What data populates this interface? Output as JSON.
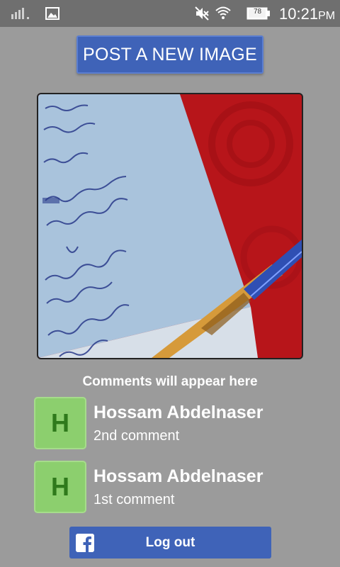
{
  "status_bar": {
    "battery_level": "78",
    "time": "10:21",
    "ampm": "PM",
    "icons": [
      "signal-icon",
      "gallery-icon",
      "mute-icon",
      "wifi-icon",
      "battery-icon"
    ]
  },
  "post_button": {
    "label": "POST A NEW IMAGE"
  },
  "image": {
    "description": "photo-of-notebook-with-pen"
  },
  "comments": {
    "heading": "Comments will appear here",
    "items": [
      {
        "avatar_letter": "H",
        "name": "Hossam Abdelnaser",
        "text": "2nd comment"
      },
      {
        "avatar_letter": "H",
        "name": "Hossam Abdelnaser",
        "text": "1st comment"
      }
    ]
  },
  "logout_button": {
    "label": "Log out",
    "icon": "facebook-icon"
  },
  "colors": {
    "background": "#9b9b9b",
    "status_bar": "#6f6f6f",
    "accent_blue": "#3f63b8",
    "avatar_green": "#8ccf6e",
    "avatar_letter": "#2f7a1c"
  }
}
